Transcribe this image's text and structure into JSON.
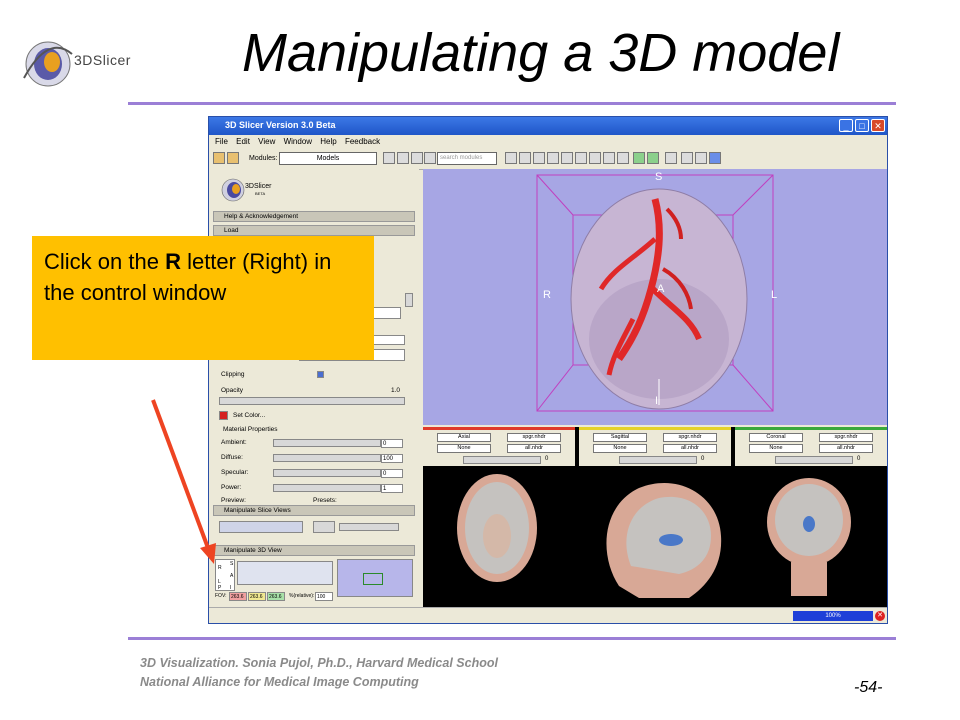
{
  "slide": {
    "title": "Manipulating a 3D model",
    "logo_text": "3DSlicer",
    "footer_line1": "3D Visualization. Sonia Pujol, Ph.D., Harvard Medical School",
    "footer_line2": "National Alliance for Medical Image Computing",
    "page_number": "-54-",
    "accent_color": "#9b7fd6"
  },
  "callout": {
    "text_before": "Click on the ",
    "bold": "R",
    "text_after": " letter (Right) in the control window",
    "color": "#ffc000"
  },
  "app": {
    "window_title": "3D Slicer Version 3.0 Beta",
    "menu": [
      "File",
      "Edit",
      "View",
      "Window",
      "Help",
      "Feedback"
    ],
    "modules_label": "Modules:",
    "modules_value": "Models",
    "search_placeholder": "search modules",
    "mini_logo_text": "3DSlicer",
    "mini_logo_sub": "BETA",
    "sections": {
      "help": "Help & Acknowledgement",
      "load": "Load",
      "material": "Material Properties",
      "slice_views": "Manipulate Slice Views",
      "view3d": "Manipulate 3D View"
    },
    "props": {
      "clipping": "Clipping",
      "opacity": "Opacity",
      "opacity_value": "1.0",
      "set_color": "Set Color...",
      "ambient": "Ambient:",
      "ambient_value": "0",
      "diffuse": "Diffuse:",
      "diffuse_value": "100",
      "specular": "Specular:",
      "specular_value": "0",
      "power": "Power:",
      "power_value": "1",
      "preview": "Preview:",
      "presets": "Presets:"
    },
    "view_control": {
      "fov_label": "FOV:",
      "fov_values": [
        "263.6",
        "263.6",
        "263.6"
      ],
      "zoom_label": "%(relative):",
      "zoom_value": "100",
      "axis_letters": [
        "S",
        "R",
        "A",
        "L",
        "P",
        "I"
      ]
    },
    "axes3d": {
      "S": "S",
      "R": "R",
      "A": "A",
      "L": "L",
      "I": "I"
    },
    "slice_views": [
      {
        "name": "Axial",
        "volume": "spgr.nhdr",
        "label": "None",
        "fg": "all.nhdr",
        "value": "0",
        "color": "#e03a2a"
      },
      {
        "name": "Sagittal",
        "volume": "spgr.nhdr",
        "label": "None",
        "fg": "all.nhdr",
        "value": "0",
        "color": "#e6d22a"
      },
      {
        "name": "Coronal",
        "volume": "spgr.nhdr",
        "label": "None",
        "fg": "all.nhdr",
        "value": "0",
        "color": "#3aa83a"
      }
    ],
    "progress": "100%"
  }
}
